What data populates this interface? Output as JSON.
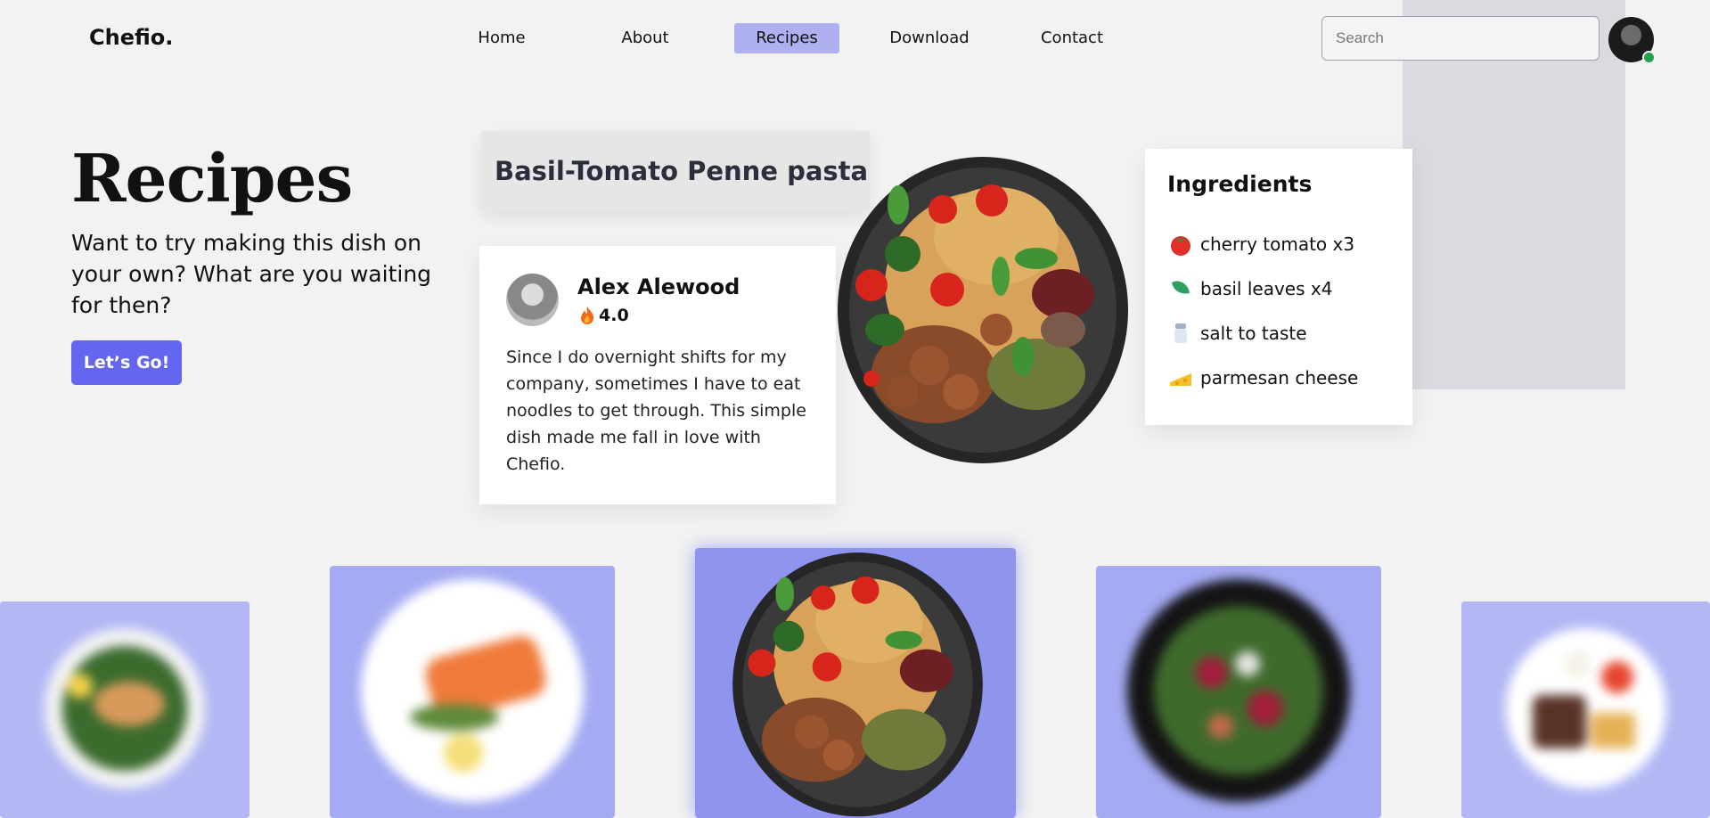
{
  "brand": {
    "logo": "Chefio."
  },
  "nav": {
    "items": [
      {
        "label": "Home",
        "active": false
      },
      {
        "label": "About",
        "active": false
      },
      {
        "label": "Recipes",
        "active": true
      },
      {
        "label": "Download",
        "active": false
      },
      {
        "label": "Contact",
        "active": false
      }
    ],
    "search_placeholder": "Search",
    "user_status": "online"
  },
  "hero": {
    "title": "Recipes",
    "subtitle": "Want to try making this dish on your own? What are you waiting for then?",
    "cta_label": "Let’s Go!"
  },
  "dish": {
    "name": "Basil-Tomato Penne pasta"
  },
  "review": {
    "author": "Alex Alewood",
    "rating": "4.0",
    "rating_icon": "fire-icon",
    "text": "Since I do overnight shifts for my company, sometimes I have to eat noodles to get through. This simple dish made me fall in love with Chefio."
  },
  "ingredients": {
    "title": "Ingredients",
    "items": [
      {
        "icon": "tomato-icon",
        "glyph": "🍅",
        "label": "cherry tomato x3"
      },
      {
        "icon": "basil-leaf-icon",
        "glyph": "",
        "label": "basil leaves x4"
      },
      {
        "icon": "salt-shaker-icon",
        "glyph": "",
        "label": "salt to taste"
      },
      {
        "icon": "cheese-icon",
        "glyph": "🧀",
        "label": "parmesan cheese"
      }
    ]
  },
  "carousel": {
    "items": [
      {
        "dish": "grilled-chicken-plate"
      },
      {
        "dish": "salmon-plate"
      },
      {
        "dish": "basil-tomato-pasta-bowl",
        "selected": true
      },
      {
        "dish": "salad-bowl"
      },
      {
        "dish": "steak-fries-plate"
      }
    ]
  },
  "colors": {
    "accent": "#6466ef",
    "active_nav": "#aeb0ef",
    "background": "#f2f2f2",
    "online": "#22a34a"
  }
}
